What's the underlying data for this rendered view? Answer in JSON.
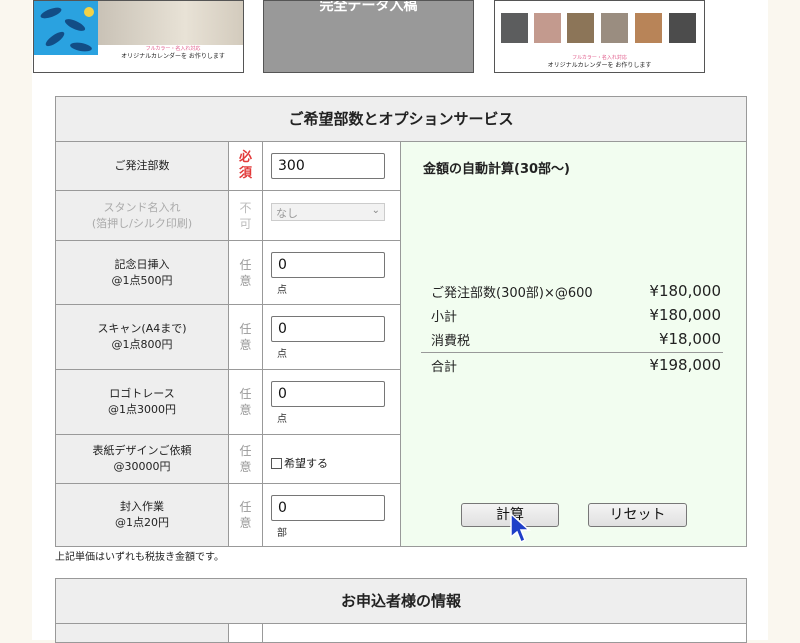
{
  "thumbnails": {
    "left_caption_small": "フルカラー・名入れ対応",
    "left_caption": "オリジナルカレンダーを お作りします",
    "middle_text": "完全データ入稿",
    "right_caption_small": "フルカラー・名入れ対応",
    "right_caption": "オリジナルカレンダーを お作りします"
  },
  "section1_title": "ご希望部数とオプションサービス",
  "rows": [
    {
      "label1": "ご発注部数",
      "label2": "",
      "req1": "必",
      "req2": "須",
      "value": "300",
      "unit": ""
    },
    {
      "label1": "スタンド名入れ",
      "label2": "(箔押し/シルク印刷)",
      "req1": "不",
      "req2": "可",
      "select": "なし"
    },
    {
      "label1": "記念日挿入",
      "label2": "@1点500円",
      "req1": "任",
      "req2": "意",
      "value": "0",
      "unit": "点"
    },
    {
      "label1": "スキャン(A4まで)",
      "label2": "@1点800円",
      "req1": "任",
      "req2": "意",
      "value": "0",
      "unit": "点"
    },
    {
      "label1": "ロゴトレース",
      "label2": "@1点3000円",
      "req1": "任",
      "req2": "意",
      "value": "0",
      "unit": "点"
    },
    {
      "label1": "表紙デザインご依頼",
      "label2": "@30000円",
      "req1": "任",
      "req2": "意",
      "checkbox_label": "希望する"
    },
    {
      "label1": "封入作業",
      "label2": "@1点20円",
      "req1": "任",
      "req2": "意",
      "value": "0",
      "unit": "部"
    }
  ],
  "calc": {
    "title": "金額の自動計算(30部〜)",
    "lines": [
      {
        "label": "ご発注部数(300部)×@600",
        "amount": "¥180,000"
      },
      {
        "label": "小計",
        "amount": "¥180,000"
      },
      {
        "label": "消費税",
        "amount": "¥18,000"
      },
      {
        "label": "合計",
        "amount": "¥198,000"
      }
    ],
    "calc_button": "計算",
    "reset_button": "リセット"
  },
  "note": "上記単価はいずれも税抜き金額です。",
  "section2_title": "お申込者様の情報",
  "colors": {
    "calc_bg": "#f2fdf0",
    "required": "#e23a3a",
    "header_bg": "#eeeeee"
  }
}
